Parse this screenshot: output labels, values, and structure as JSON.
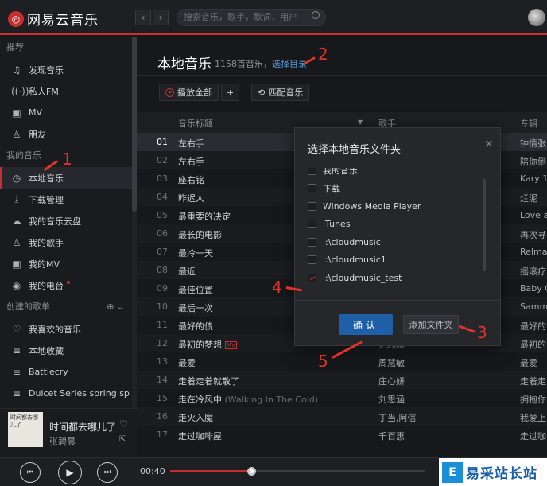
{
  "app": {
    "name": "网易云音乐"
  },
  "topbar": {
    "search_placeholder": "搜索音乐，歌手，歌词，用户"
  },
  "sidebar": {
    "sec_recommend": "推荐",
    "recommend": [
      "发现音乐",
      "私人FM",
      "MV",
      "朋友"
    ],
    "sec_mymusic": "我的音乐",
    "mymusic": [
      "本地音乐",
      "下载管理",
      "我的音乐云盘",
      "我的歌手",
      "我的MV",
      "我的电台"
    ],
    "sec_created": "创建的歌单",
    "created": [
      "我喜欢的音乐",
      "本地收藏",
      "Battlecry",
      "Dulcet Series spring sp"
    ]
  },
  "main": {
    "title": "本地音乐",
    "count": "1158首音乐，",
    "select_dir": "选择目录",
    "play_all": "播放全部",
    "add": "+",
    "match": "匹配音乐",
    "headers": {
      "title": "音乐标题",
      "artist": "歌手",
      "album": "专辑"
    },
    "rows": [
      {
        "num": "01",
        "title": "左右手",
        "sub": "",
        "mv": "",
        "artist": "",
        "album": "钟情张"
      },
      {
        "num": "02",
        "title": "左右手",
        "sub": "",
        "mv": "",
        "artist": "",
        "album": "陪你倒"
      },
      {
        "num": "03",
        "title": "座右铭",
        "sub": "",
        "mv": "",
        "artist": "",
        "album": "Kary 1"
      },
      {
        "num": "04",
        "title": "昨迟人",
        "sub": "",
        "mv": "",
        "artist": "",
        "album": "烂泥"
      },
      {
        "num": "05",
        "title": "最重要的决定",
        "sub": "",
        "mv": "",
        "artist": "",
        "album": "Love ar"
      },
      {
        "num": "06",
        "title": "最长的电影",
        "sub": "",
        "mv": "",
        "artist": "",
        "album": "再次寻"
      },
      {
        "num": "07",
        "title": "最冷一天",
        "sub": "",
        "mv": "",
        "artist": "",
        "album": "Relmat"
      },
      {
        "num": "08",
        "title": "最近",
        "sub": "",
        "mv": "",
        "artist": "",
        "album": "摇滚疗"
      },
      {
        "num": "09",
        "title": "最佳位置",
        "sub": "",
        "mv": "",
        "artist": "",
        "album": "Baby C"
      },
      {
        "num": "10",
        "title": "最后一次",
        "sub": "",
        "mv": "",
        "artist": "",
        "album": "Samm"
      },
      {
        "num": "11",
        "title": "最好的债",
        "sub": "",
        "mv": "",
        "artist": "",
        "album": "最好的"
      },
      {
        "num": "12",
        "title": "最初的梦想",
        "sub": "",
        "mv": "MV",
        "artist": "范玮琪",
        "album": "最初的"
      },
      {
        "num": "13",
        "title": "最爱",
        "sub": "",
        "mv": "",
        "artist": "周慧敏",
        "album": "最爱"
      },
      {
        "num": "14",
        "title": "走着走着就散了",
        "sub": "",
        "mv": "",
        "artist": "庄心妍",
        "album": "走着走"
      },
      {
        "num": "15",
        "title": "走在冷风中",
        "sub": "(Walking In The Cold)",
        "mv": "",
        "artist": "刘思涵",
        "album": "拥抱你"
      },
      {
        "num": "16",
        "title": "走火入魔",
        "sub": "",
        "mv": "",
        "artist": "丁当,阿信",
        "album": "我爱上"
      },
      {
        "num": "17",
        "title": "走过咖啡屋",
        "sub": "",
        "mv": "",
        "artist": "千百惠",
        "album": "走过咖"
      }
    ]
  },
  "modal": {
    "title": "选择本地音乐文件夹",
    "close": "×",
    "items": [
      {
        "label": "我的音乐",
        "checked": false
      },
      {
        "label": "下载",
        "checked": false
      },
      {
        "label": "Windows Media Player",
        "checked": false
      },
      {
        "label": "iTunes",
        "checked": false
      },
      {
        "label": "i:\\cloudmusic",
        "checked": false
      },
      {
        "label": "i:\\cloudmusic1",
        "checked": false
      },
      {
        "label": "i:\\cloudmusic_test",
        "checked": true
      }
    ],
    "ok": "确认",
    "add_folder": "添加文件夹"
  },
  "annotations": [
    "1",
    "2",
    "3",
    "4",
    "5"
  ],
  "player": {
    "song": "时间都去哪儿了",
    "singer": "张碧晨",
    "cover_text": "时间都去哪儿了",
    "elapsed": "00:40",
    "progress": 0.32
  },
  "watermark": {
    "text": "易采站长站",
    "logo": "E"
  }
}
